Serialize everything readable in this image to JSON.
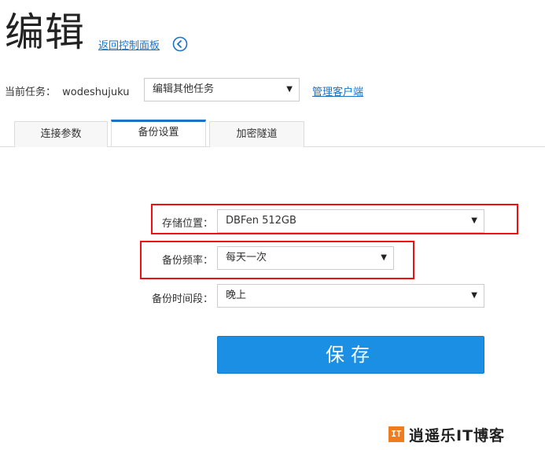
{
  "page": {
    "title": "编辑",
    "back_link": "返回控制面板"
  },
  "task": {
    "label": "当前任务：",
    "name": "wodeshujuku",
    "select_value": "编辑其他任务",
    "manage_link": "管理客户端"
  },
  "tabs": [
    {
      "label": "连接参数",
      "active": false
    },
    {
      "label": "备份设置",
      "active": true
    },
    {
      "label": "加密隧道",
      "active": false
    }
  ],
  "form": {
    "storage": {
      "label": "存储位置：",
      "value": "DBFen 512GB"
    },
    "frequency": {
      "label": "备份频率：",
      "value": "每天一次"
    },
    "time_slot": {
      "label": "备份时间段：",
      "value": "晚上"
    }
  },
  "save_label": "保存",
  "watermark": {
    "logo": "IT",
    "text": "逍遥乐IT博客"
  },
  "colors": {
    "link": "#1a73c8",
    "button": "#1a8fe3",
    "highlight": "#e11111",
    "logo": "#f07c1e"
  }
}
